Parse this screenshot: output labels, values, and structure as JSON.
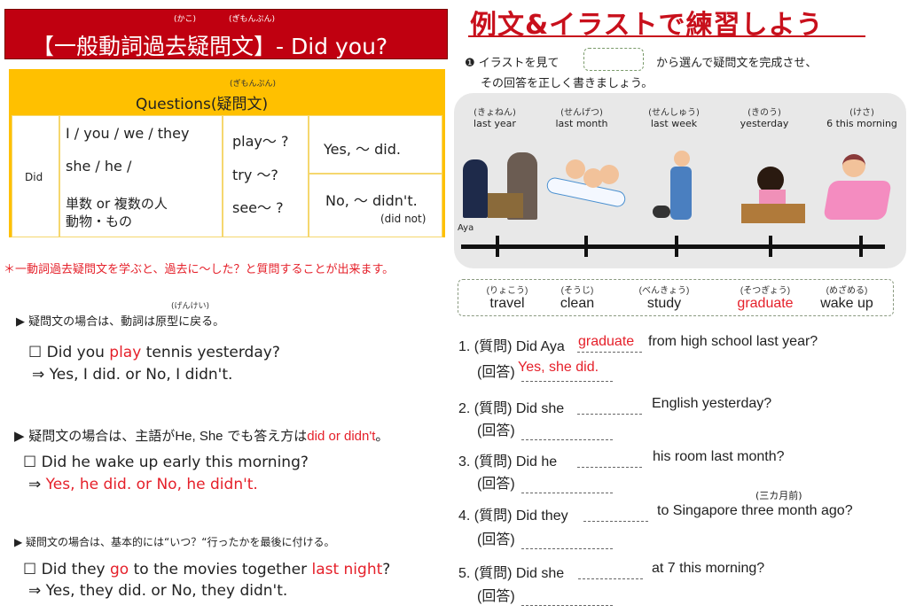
{
  "left": {
    "banner": {
      "title": "【一般動詞過去疑問文】- Did you?",
      "furigana_kako": "(かこ)",
      "furigana_gimonbun": "(ぎもんぷん)"
    },
    "table": {
      "header": "Questions(疑問文)",
      "header_furigana": "(ぎもんぷん)",
      "did": "Did",
      "subjects": [
        "I / you / we / they",
        "she / he /",
        "単数 or 複数の人",
        "動物・もの"
      ],
      "verbs": [
        "play～ ?",
        "try ～?",
        "see～ ?"
      ],
      "yes": "Yes, ～ did.",
      "no": "No, ～ didn't.",
      "no_full": "(did not)"
    },
    "note": "＊一動詞過去疑問文を学ぶと、過去に～した？と質問することが出来ます。",
    "sections": [
      {
        "furigana": "(げんけい)",
        "rule": "▶ 疑問文の場合は、動詞は原型に戻る。",
        "q": [
          "☐ Did you ",
          "play",
          " tennis yesterday?"
        ],
        "a": "⇒ Yes, I did. or No, I didn't."
      },
      {
        "rule": [
          "▶ 疑問文の場合は、主語が",
          "He, She",
          " でも答え方は",
          "did or didn't",
          "。"
        ],
        "q": "☐ Did he wake up early this morning?",
        "a_arrow": "⇒ ",
        "a": "Yes, he did. or No, he didn't."
      },
      {
        "rule": "▶ 疑問文の場合は、基本的には“いつ？“行ったかを最後に付ける。",
        "q": [
          "☐ Did they ",
          "go",
          " to the movies together ",
          "last night",
          "?"
        ],
        "a": "⇒ Yes, they did. or No, they didn't."
      }
    ]
  },
  "right": {
    "title": "例文&イラストで練習しよう",
    "instructions": [
      "❶ イラストを見て",
      "から選んで疑問文を完成させ、",
      "その回答を正しく書きましょう。"
    ],
    "timeline": {
      "name": "Aya",
      "points": [
        {
          "furigana": "(きょねん)",
          "label": "last year"
        },
        {
          "furigana": "(せんげつ)",
          "label": "last month"
        },
        {
          "furigana": "(せんしゅう)",
          "label": "last week"
        },
        {
          "furigana": "(きのう)",
          "label": "yesterday"
        },
        {
          "furigana": "(けさ)",
          "label": "6 this morning"
        }
      ]
    },
    "words": [
      {
        "furigana": "(りょこう)",
        "word": "travel"
      },
      {
        "furigana": "(そうじ)",
        "word": "clean"
      },
      {
        "furigana": "(べんきょう)",
        "word": "study"
      },
      {
        "furigana": "(そつぎょう)",
        "word": "graduate"
      },
      {
        "furigana": "(めざめる)",
        "word": "wake up"
      }
    ],
    "answer_label": "(回答)",
    "questions": [
      {
        "pre": "1. (質問) Did Aya",
        "fill": "graduate",
        "post": "from high school last year?",
        "answer": "Yes, she did."
      },
      {
        "pre": "2. (質問) Did she",
        "post": "English yesterday?"
      },
      {
        "pre": "3. (質問) Did he",
        "post": "his room last month?"
      },
      {
        "pre": "4. (質問) Did they",
        "post": "to Singapore three month ago?",
        "note": "(三カ月前)"
      },
      {
        "pre": "5. (質問) Did she",
        "post": "at 7 this morning?"
      }
    ],
    "colors": {
      "accent_red": "#e5202a",
      "banner": "#c00010",
      "table_yellow": "#ffc000"
    }
  }
}
